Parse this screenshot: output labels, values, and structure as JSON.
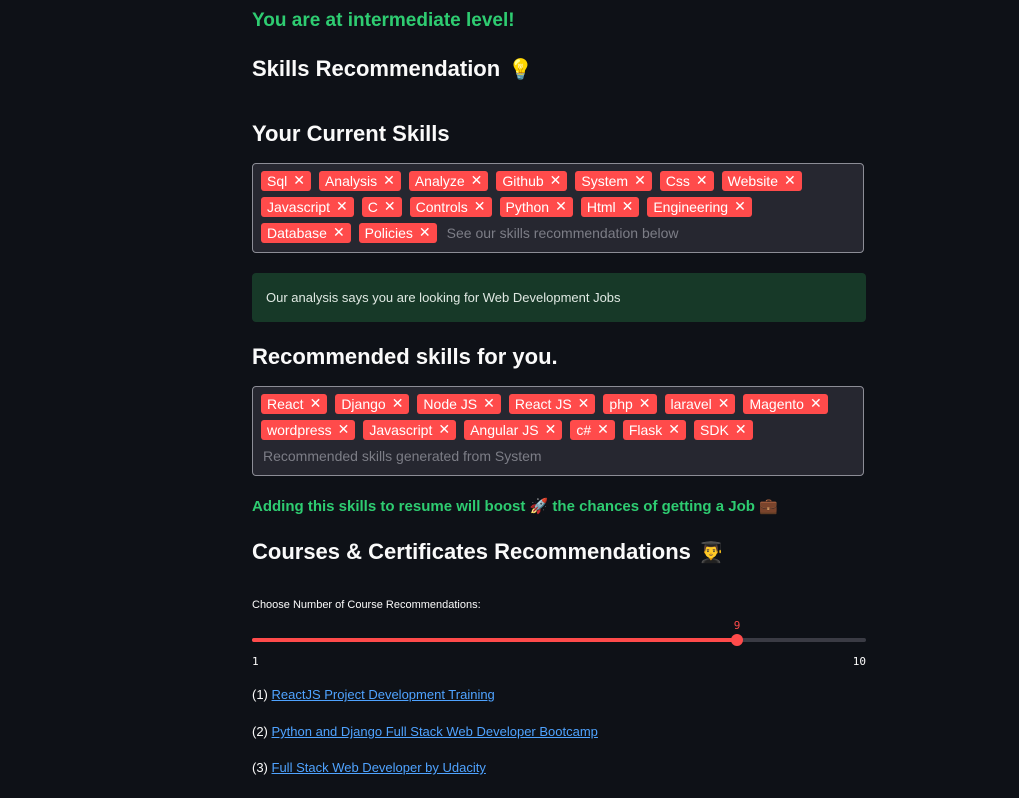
{
  "level_text": "You are at intermediate level!",
  "skills_heading": "Skills Recommendation",
  "skills_heading_emoji": "💡",
  "current_skills_heading": "Your Current Skills",
  "current_skills": [
    "Sql",
    "Analysis",
    "Analyze",
    "Github",
    "System",
    "Css",
    "Website",
    "Javascript",
    "C",
    "Controls",
    "Python",
    "Html",
    "Engineering",
    "Database",
    "Policies"
  ],
  "current_skills_placeholder": "See our skills recommendation below",
  "analysis_message": "Our analysis says you are looking for Web Development Jobs",
  "recommended_heading": "Recommended skills for you.",
  "recommended_skills": [
    "React",
    "Django",
    "Node JS",
    "React JS",
    "php",
    "laravel",
    "Magento",
    "wordpress",
    "Javascript",
    "Angular JS",
    "c#",
    "Flask",
    "SDK"
  ],
  "recommended_placeholder": "Recommended skills generated from System",
  "boost_text_1": "Adding this skills to resume will boost",
  "boost_emoji_1": "🚀",
  "boost_text_2": "the chances of getting a Job",
  "boost_emoji_2": "💼",
  "courses_heading": "Courses & Certificates Recommendations",
  "courses_heading_emoji": "👨‍🎓",
  "slider": {
    "label": "Choose Number of Course Recommendations:",
    "min": 1,
    "max": 10,
    "value": 9,
    "min_label": "1",
    "max_label": "10",
    "value_label": "9"
  },
  "courses": [
    {
      "index": "(1)",
      "title": "ReactJS Project Development Training"
    },
    {
      "index": "(2)",
      "title": "Python and Django Full Stack Web Developer Bootcamp"
    },
    {
      "index": "(3)",
      "title": "Full Stack Web Developer by Udacity"
    }
  ],
  "colors": {
    "accent": "#ff4b4b",
    "success": "#2ecc71",
    "info_bg": "#173928",
    "link": "#4fa3ff",
    "background": "#0e1117"
  },
  "icons": {
    "remove_tag": "close-icon"
  }
}
